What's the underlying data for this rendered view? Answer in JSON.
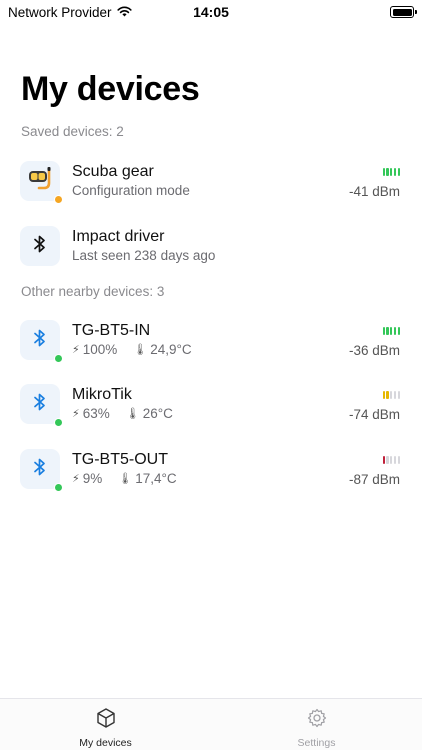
{
  "status_bar": {
    "carrier": "Network Provider",
    "time": "14:05",
    "wifi_icon": "wifi-icon",
    "battery_icon": "battery-icon"
  },
  "page": {
    "title": "My devices"
  },
  "saved_section": {
    "label": "Saved devices: 2",
    "devices": [
      {
        "name": "Scuba gear",
        "subtitle": "Configuration mode",
        "icon": "diving-mask-icon",
        "status_color": "#f5a623",
        "rssi": "-41 dBm",
        "signal_bars": 5,
        "signal_color": "#34c759"
      },
      {
        "name": "Impact driver",
        "subtitle": "Last seen 238 days ago",
        "icon": "bluetooth-icon"
      }
    ]
  },
  "nearby_section": {
    "label": "Other nearby devices: 3",
    "devices": [
      {
        "name": "TG-BT5-IN",
        "battery": "100%",
        "temperature": "24,9°C",
        "icon": "bluetooth-icon",
        "status_color": "#34c759",
        "rssi": "-36 dBm",
        "signal_bars": 5,
        "signal_color": "#34c759"
      },
      {
        "name": "MikroTik",
        "battery": "63%",
        "temperature": "26°C",
        "icon": "bluetooth-icon",
        "status_color": "#34c759",
        "rssi": "-74 dBm",
        "signal_bars": 2,
        "signal_color": "#e6b800"
      },
      {
        "name": "TG-BT5-OUT",
        "battery": "9%",
        "temperature": "17,4°C",
        "icon": "bluetooth-icon",
        "status_color": "#34c759",
        "rssi": "-87 dBm",
        "signal_bars": 1,
        "signal_color": "#c0213a"
      }
    ]
  },
  "tab_bar": {
    "tabs": [
      {
        "label": "My devices",
        "icon": "cube-icon",
        "active": true
      },
      {
        "label": "Settings",
        "icon": "gear-icon",
        "active": false
      }
    ]
  },
  "colors": {
    "accent": "#1a7fe0",
    "icon_bg": "#eef4fb"
  }
}
